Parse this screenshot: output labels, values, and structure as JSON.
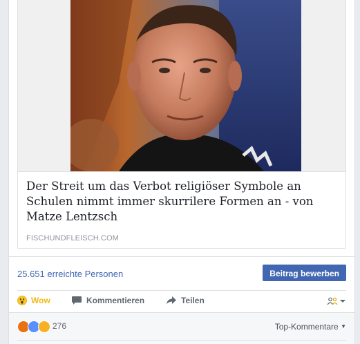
{
  "link_preview": {
    "headline": "Der Streit um das Verbot religiöser Symbole an Schulen nimmt immer skurrilere Formen an - von Matze Lentzsch",
    "domain": "FISCHUNDFLEISCH.COM"
  },
  "stats": {
    "reach": "25.651 erreichte Personen",
    "promote_label": "Beitrag bewerben"
  },
  "actions": {
    "wow_label": "Wow",
    "comment_label": "Kommentieren",
    "share_label": "Teilen",
    "wow_icon": "wow-emoji-icon",
    "comment_icon": "speech-bubble-icon",
    "share_icon": "share-arrow-icon"
  },
  "reactions": {
    "count": "276",
    "icons": [
      "angry-emoji",
      "like-thumb",
      "sad-emoji"
    ],
    "sort_label": "Top-Kommentare"
  },
  "colors": {
    "accent": "#4267b2",
    "wow": "#f0ba15",
    "angry": "#e9710f",
    "like": "#5890ff",
    "sad": "#f7b125"
  }
}
